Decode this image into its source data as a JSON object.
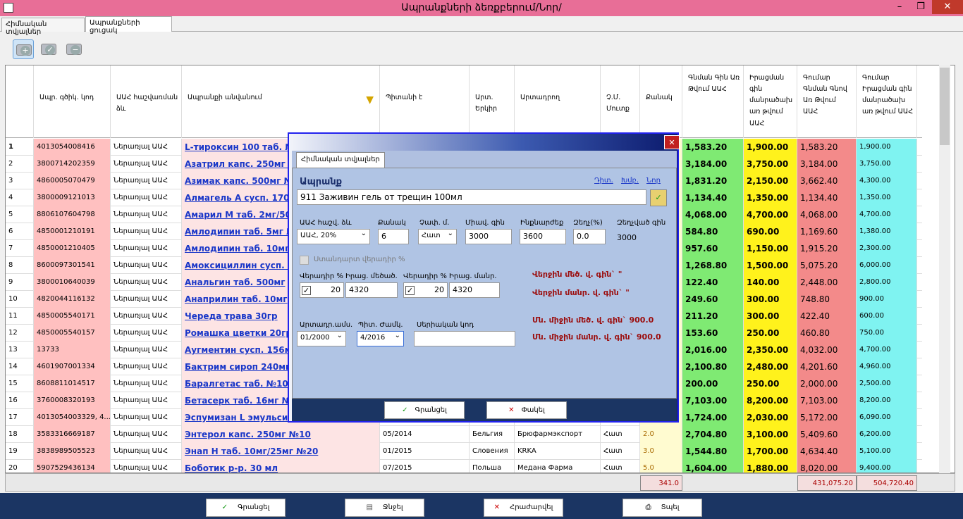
{
  "title": "Ապրանքների ձեռքբերում/Նոր/",
  "window_buttons": {
    "minimize": "–",
    "restore": "❐",
    "close": "✕"
  },
  "tabs": [
    "Հիմնական տվյալներ",
    "Ապրանքների ցուցակ"
  ],
  "grid": {
    "headers": [
      "Ապր. գծիկ. կոդ",
      "ԱԱՀ հաշվառման ձև",
      "Ապրանքի անվանում",
      "Պիտանի է",
      "Արտ. Երկիր",
      "Արտադրող",
      "Չ.Մ. Մուտք",
      "Քանակ",
      "Գնման Գին Առ Թվում ԱԱՀ",
      "Իրացման գին մանրածախ առ թվում ԱԱՀ",
      "Գումար Գնման Գնով Առ Թվում ԱԱՀ",
      "Գումար Իրացման գին մանրածախ առ թվում ԱԱՀ"
    ],
    "rows": [
      [
        "1",
        "4013054008416",
        "Ներառյալ ԱԱՀ",
        "L-тироксин 100 таб. №",
        "",
        "",
        "",
        "",
        "",
        "1,583.20",
        "1,900.00",
        "1,583.20",
        "1,900.00"
      ],
      [
        "2",
        "3800714202359",
        "Ներառյալ ԱԱՀ",
        "Азатрил капс. 250мг №",
        "",
        "",
        "",
        "",
        "",
        "3,184.00",
        "3,750.00",
        "3,184.00",
        "3,750.00"
      ],
      [
        "3",
        "4860005070479",
        "Ներառյալ ԱԱՀ",
        "Азимак капс. 500мг №",
        "",
        "",
        "",
        "",
        "",
        "1,831.20",
        "2,150.00",
        "3,662.40",
        "4,300.00"
      ],
      [
        "4",
        "3800009121013",
        "Ներառյալ ԱԱՀ",
        "Алмагель А сусп. 170",
        "",
        "",
        "",
        "",
        "",
        "1,134.40",
        "1,350.00",
        "1,134.40",
        "1,350.00"
      ],
      [
        "5",
        "8806107604798",
        "Ներառյալ ԱԱՀ",
        "Амарил М таб. 2мг/50",
        "",
        "",
        "",
        "",
        "",
        "4,068.00",
        "4,700.00",
        "4,068.00",
        "4,700.00"
      ],
      [
        "6",
        "4850001210191",
        "Ներառյալ ԱԱՀ",
        "Амлодипин таб. 5мг №",
        "",
        "",
        "",
        "",
        "",
        "584.80",
        "690.00",
        "1,169.60",
        "1,380.00"
      ],
      [
        "7",
        "4850001210405",
        "Ներառյալ ԱԱՀ",
        "Амлодипин таб. 10мг",
        "",
        "",
        "",
        "",
        "",
        "957.60",
        "1,150.00",
        "1,915.20",
        "2,300.00"
      ],
      [
        "8",
        "8600097301541",
        "Ներառյալ ԱԱՀ",
        "Амоксициллин сусп. 2",
        "",
        "",
        "",
        "",
        "",
        "1,268.80",
        "1,500.00",
        "5,075.20",
        "6,000.00"
      ],
      [
        "9",
        "3800010640039",
        "Ներառյալ ԱԱՀ",
        "Анальгин таб. 500мг",
        "",
        "",
        "",
        "",
        "",
        "122.40",
        "140.00",
        "2,448.00",
        "2,800.00"
      ],
      [
        "10",
        "4820044116132",
        "Ներառյալ ԱԱՀ",
        "Анаприлин таб. 10мг",
        "",
        "",
        "",
        "",
        "",
        "249.60",
        "300.00",
        "748.80",
        "900.00"
      ],
      [
        "11",
        "4850005540171",
        "Ներառյալ ԱԱՀ",
        "Череда трава 30гр",
        "",
        "",
        "",
        "",
        "",
        "211.20",
        "300.00",
        "422.40",
        "600.00"
      ],
      [
        "12",
        "4850005540157",
        "Ներառյալ ԱԱՀ",
        "Ромашка цветки 20гр",
        "",
        "",
        "",
        "",
        "",
        "153.60",
        "250.00",
        "460.80",
        "750.00"
      ],
      [
        "13",
        "13733",
        "Ներառյալ ԱԱՀ",
        "Аугментин сусп. 156м",
        "",
        "",
        "",
        "",
        "",
        "2,016.00",
        "2,350.00",
        "4,032.00",
        "4,700.00"
      ],
      [
        "14",
        "4601907001334",
        "Ներառյալ ԱԱՀ",
        "Бактрим сироп 240мг",
        "",
        "",
        "",
        "",
        "",
        "2,100.80",
        "2,480.00",
        "4,201.60",
        "4,960.00"
      ],
      [
        "15",
        "8608811014517",
        "Ներառյալ ԱԱՀ",
        "Баралгетас таб. №10",
        "",
        "",
        "",
        "",
        "",
        "200.00",
        "250.00",
        "2,000.00",
        "2,500.00"
      ],
      [
        "16",
        "3760008320193",
        "Ներառյալ ԱԱՀ",
        "Бетасерк таб. 16мг №",
        "",
        "",
        "",
        "",
        "",
        "7,103.00",
        "8,200.00",
        "7,103.00",
        "8,200.00"
      ],
      [
        "17",
        "4013054003329, 4...",
        "Ներառյալ ԱԱՀ",
        "Эспумизан L эмульсия",
        "",
        "",
        "",
        "",
        "",
        "1,724.00",
        "2,030.00",
        "5,172.00",
        "6,090.00"
      ],
      [
        "18",
        "3583316669187",
        "Ներառյալ ԱԱՀ",
        "Энтерол капс. 250мг №10",
        "05/2014",
        "Бельгия",
        "Брюфармэкспорт",
        "Հատ",
        "2.0",
        "2,704.80",
        "3,100.00",
        "5,409.60",
        "6,200.00"
      ],
      [
        "19",
        "3838989505523",
        "Ներառյալ ԱԱՀ",
        "Энап Н таб. 10мг/25мг №20",
        "01/2015",
        "Словения",
        "KRKA",
        "Հատ",
        "3.0",
        "1,544.80",
        "1,700.00",
        "4,634.40",
        "5,100.00"
      ],
      [
        "20",
        "5907529436134",
        "Ներառյալ ԱԱՀ",
        "Боботик р-р. 30 мл",
        "07/2015",
        "Польша",
        "Медана Фарма",
        "Հատ",
        "5.0",
        "1,604.00",
        "1,880.00",
        "8,020.00",
        "9,400.00"
      ]
    ],
    "totals": {
      "count": "341.0",
      "sum_purchase": "431,075.20",
      "sum_retail": "504,720.40"
    }
  },
  "bottom_buttons": [
    "Գրանցել",
    "Ջնջել",
    "Հրաժարվել",
    "Տպել"
  ],
  "dialog": {
    "tab": "Հիմնական տվյալներ",
    "product_label": "Ապրանք",
    "links": [
      "Դիտ.",
      "Խմբ.",
      "Նոր"
    ],
    "product_value": "911 Заживин гель от трещин  100мл",
    "labels": {
      "vat": "ԱԱՀ հաշվ. ձև",
      "qty": "Քանակ",
      "unit": "Չափ. մ.",
      "price": "Միավ. գին",
      "cost": "Ինքնարժեք",
      "discount": "Զեղչ(%)",
      "disc_price": "Զեղչված գին"
    },
    "values": {
      "vat": "ԱԱՀ, 20%",
      "qty": "6",
      "unit": "Հատ",
      "price": "3000",
      "cost": "3600",
      "discount": "0.0",
      "disc_price": "3000"
    },
    "markup_std": "Ստանդարտ վերադիր %",
    "labels2": {
      "m1": "Վերադիր %",
      "p1": "Իրաց. մեծած.",
      "m2": "Վերադիր %",
      "p2": "Իրաց. մանր."
    },
    "values2": {
      "m1": "20",
      "p1": "4320",
      "m2": "20",
      "p2": "4320"
    },
    "warn_last_wholesale": "Վերջին մեծ. վ. գին` \"",
    "warn_last_retail": "Վերջին մանր. վ. գին` \"",
    "labels3": {
      "made": "Արտադր.ամս.",
      "exp": "Պիտ. Ժամկ.",
      "serial": "Սերիական կոդ"
    },
    "values3": {
      "made": "01/2000",
      "exp": "4/2016",
      "serial": ""
    },
    "avg_wholesale": "Մն. միջին մեծ. վ. գին` 900.0",
    "avg_retail": "Մն. միջին մանր. վ. գին` 900.0",
    "ok": "Գրանցել",
    "cancel": "Փակել"
  }
}
